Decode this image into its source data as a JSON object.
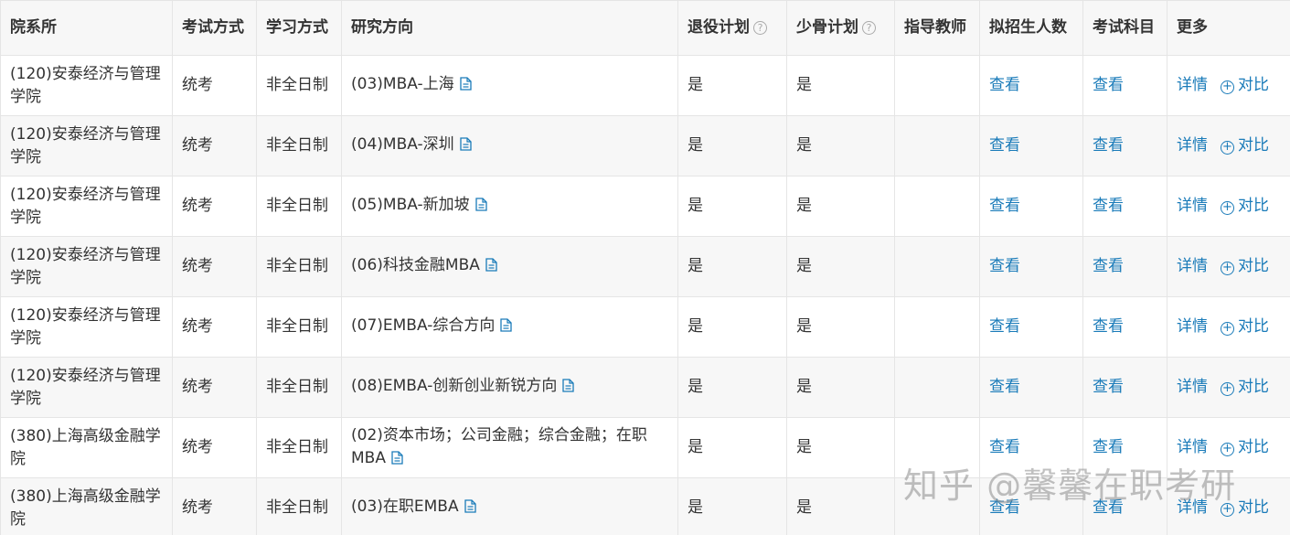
{
  "headers": {
    "dept": "院系所",
    "exam_mode": "考试方式",
    "study_mode": "学习方式",
    "direction": "研究方向",
    "retired_plan": "退役计划",
    "backbone_plan": "少骨计划",
    "advisor": "指导教师",
    "enroll_count": "拟招生人数",
    "subjects": "考试科目",
    "more": "更多"
  },
  "icons": {
    "help": "question-circle-icon",
    "doc": "document-icon",
    "compare": "plus-circle-icon"
  },
  "help_glyph": "?",
  "plus_glyph": "+",
  "link_color": "#1a7bb9",
  "rows": [
    {
      "dept": "(120)安泰经济与管理学院",
      "exam": "统考",
      "study": "非全日制",
      "direction": "(03)MBA-上海",
      "retired": "是",
      "backbone": "是",
      "advisor": "",
      "count_link": "查看",
      "subjects_link": "查看",
      "detail_link": "详情",
      "compare_link": "对比"
    },
    {
      "dept": "(120)安泰经济与管理学院",
      "exam": "统考",
      "study": "非全日制",
      "direction": "(04)MBA-深圳",
      "retired": "是",
      "backbone": "是",
      "advisor": "",
      "count_link": "查看",
      "subjects_link": "查看",
      "detail_link": "详情",
      "compare_link": "对比"
    },
    {
      "dept": "(120)安泰经济与管理学院",
      "exam": "统考",
      "study": "非全日制",
      "direction": "(05)MBA-新加坡",
      "retired": "是",
      "backbone": "是",
      "advisor": "",
      "count_link": "查看",
      "subjects_link": "查看",
      "detail_link": "详情",
      "compare_link": "对比"
    },
    {
      "dept": "(120)安泰经济与管理学院",
      "exam": "统考",
      "study": "非全日制",
      "direction": "(06)科技金融MBA",
      "retired": "是",
      "backbone": "是",
      "advisor": "",
      "count_link": "查看",
      "subjects_link": "查看",
      "detail_link": "详情",
      "compare_link": "对比"
    },
    {
      "dept": "(120)安泰经济与管理学院",
      "exam": "统考",
      "study": "非全日制",
      "direction": "(07)EMBA-综合方向",
      "retired": "是",
      "backbone": "是",
      "advisor": "",
      "count_link": "查看",
      "subjects_link": "查看",
      "detail_link": "详情",
      "compare_link": "对比"
    },
    {
      "dept": "(120)安泰经济与管理学院",
      "exam": "统考",
      "study": "非全日制",
      "direction": "(08)EMBA-创新创业新锐方向",
      "retired": "是",
      "backbone": "是",
      "advisor": "",
      "count_link": "查看",
      "subjects_link": "查看",
      "detail_link": "详情",
      "compare_link": "对比"
    },
    {
      "dept": "(380)上海高级金融学院",
      "exam": "统考",
      "study": "非全日制",
      "direction": "(02)资本市场；公司金融；综合金融；在职MBA",
      "retired": "是",
      "backbone": "是",
      "advisor": "",
      "count_link": "查看",
      "subjects_link": "查看",
      "detail_link": "详情",
      "compare_link": "对比"
    },
    {
      "dept": "(380)上海高级金融学院",
      "exam": "统考",
      "study": "非全日制",
      "direction": "(03)在职EMBA",
      "retired": "是",
      "backbone": "是",
      "advisor": "",
      "count_link": "查看",
      "subjects_link": "查看",
      "detail_link": "详情",
      "compare_link": "对比"
    }
  ],
  "watermark": "知乎 @馨馨在职考研"
}
